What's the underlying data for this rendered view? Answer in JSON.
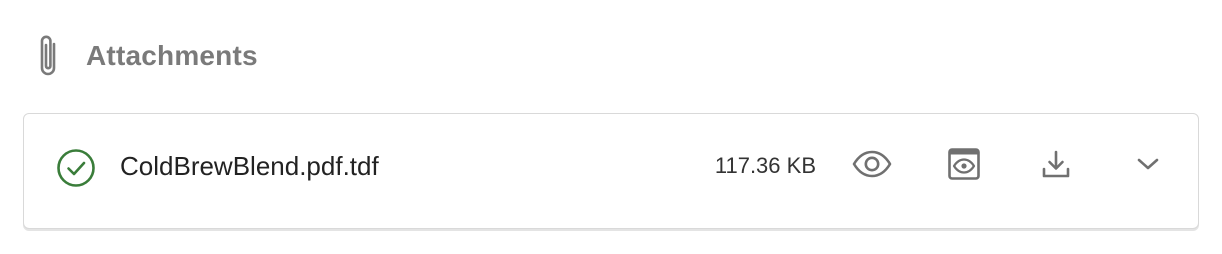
{
  "section": {
    "title": "Attachments",
    "icon": "paperclip-icon"
  },
  "attachment": {
    "file_name": "ColdBrewBlend.pdf.tdf",
    "file_size": "117.36 KB",
    "status": "uploaded",
    "status_color": "#3a7d3a",
    "actions": {
      "view_icon": "eye-icon",
      "preview_icon": "preview-window-icon",
      "download_icon": "download-icon",
      "expand_icon": "chevron-down-icon"
    }
  },
  "colors": {
    "title": "#7a7a7a",
    "icon_gray": "#707070",
    "border": "#d9d9d9",
    "success": "#3a7d3a"
  }
}
